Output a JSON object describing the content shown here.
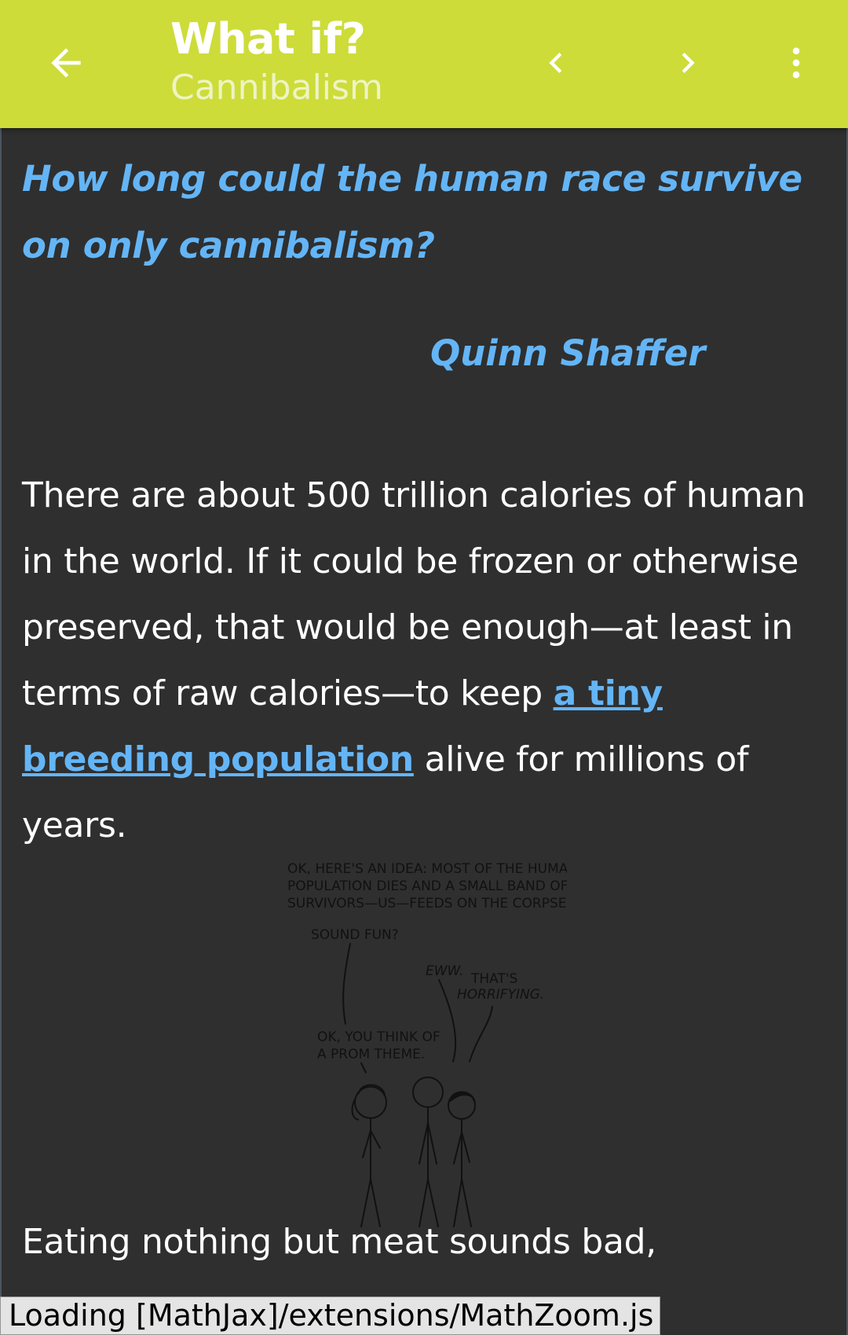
{
  "appbar": {
    "title": "What if?",
    "subtitle": "Cannibalism",
    "icons": {
      "back": "arrow-left-icon",
      "prev": "chevron-left-icon",
      "next": "chevron-right-icon",
      "more": "more-vertical-icon"
    },
    "color": "#cddc39"
  },
  "article": {
    "question": "How long could the human race survive on only cannibalism?",
    "author": "Quinn Shaffer",
    "paragraph1": {
      "text_before": "There are about 500 trillion calories of human in the world. If it could be frozen or otherwise preserved, that would be enough—at least in terms of raw calories—to keep ",
      "link_text": "a tiny breeding population",
      "text_after": " alive for millions of years."
    },
    "comic": {
      "line1": "OK, HERE'S AN IDEA: MOST OF THE HUMAN",
      "line2": "POPULATION DIES AND A SMALL BAND OF",
      "line3": "SURVIVORS—US—FEEDS ON THE CORPSES.",
      "line4": "SOUND FUN?",
      "eww": "EWW.",
      "thats": "THAT'S",
      "horrifying": "HORRIFYING.",
      "prom1": "OK, YOU THINK OF",
      "prom2": "A PROM THEME."
    },
    "paragraph2": "Eating nothing but meat sounds bad,"
  },
  "status": {
    "mathjax": "Loading [MathJax]/extensions/MathZoom.js"
  },
  "colors": {
    "background": "#2f2f2f",
    "accent": "#64b5f6",
    "text": "#ffffff"
  }
}
